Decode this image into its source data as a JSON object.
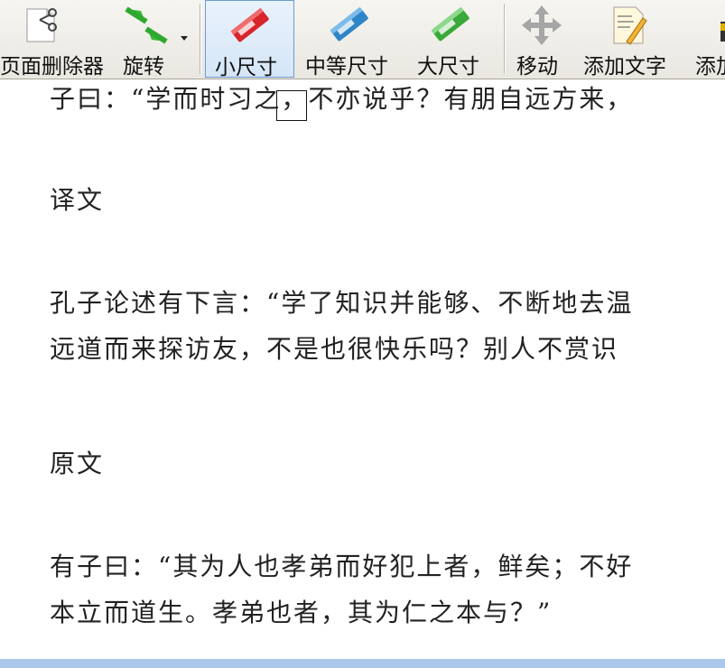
{
  "toolbar": {
    "buttons": [
      {
        "id": "page-delete",
        "label": "页面删除器"
      },
      {
        "id": "rotate",
        "label": "旋转"
      },
      {
        "id": "small-size",
        "label": "小尺寸"
      },
      {
        "id": "medium-size",
        "label": "中等尺寸"
      },
      {
        "id": "large-size",
        "label": "大尺寸"
      },
      {
        "id": "move",
        "label": "移动"
      },
      {
        "id": "add-text",
        "label": "添加文字"
      },
      {
        "id": "add-more",
        "label": "添加"
      }
    ],
    "active": "small-size",
    "colors": {
      "small_eraser": "#d8242a",
      "medium_eraser": "#2e86c8",
      "large_eraser": "#3aa83a"
    }
  },
  "document": {
    "lines": [
      "子曰：“学而时习之，不亦说乎？有朋自远方来，",
      "译文",
      "孔子论述有下言：“学了知识并能够、不断地去温",
      "远道而来探访友，不是也很快乐吗？别人不赏识",
      "原文",
      "有子曰：“其为人也孝弟而好犯上者，鲜矣；不好",
      "本立而道生。孝弟也者，其为仁之本与？”"
    ]
  },
  "statusbar": {
    "color": "#a9c8ec"
  }
}
